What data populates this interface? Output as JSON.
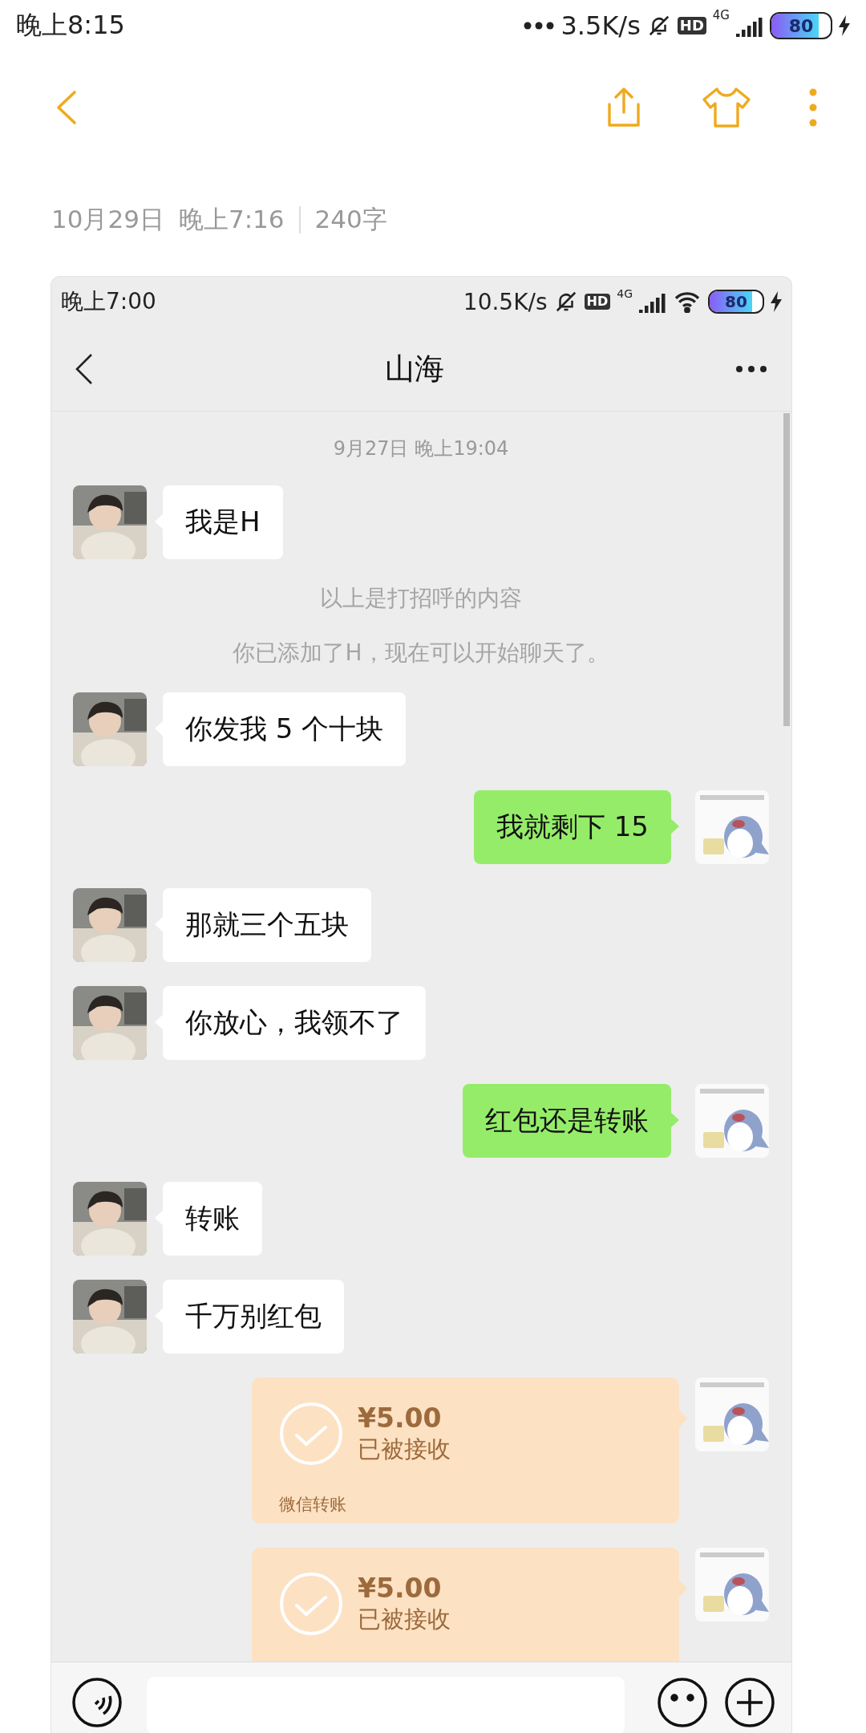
{
  "status_bar": {
    "time": "晚上8:15",
    "speed": "3.5K/s",
    "hd": "HD",
    "network": "4G",
    "battery": "80",
    "charging": true
  },
  "note_meta": {
    "date": "10月29日",
    "time": "晚上7:16",
    "word_count": "240字"
  },
  "screenshot": {
    "status_bar": {
      "time": "晚上7:00",
      "speed": "10.5K/s",
      "hd": "HD",
      "network": "4G",
      "wifi": true,
      "battery": "80",
      "charging": true
    },
    "chat_title": "山海",
    "messages": [
      {
        "kind": "time",
        "text": "9月27日 晚上19:04"
      },
      {
        "kind": "text",
        "outgoing": false,
        "text": "我是H"
      },
      {
        "kind": "notice",
        "text": "以上是打招呼的内容"
      },
      {
        "kind": "notice",
        "text": "你已添加了H，现在可以开始聊天了。"
      },
      {
        "kind": "text",
        "outgoing": false,
        "text": "你发我 5 个十块"
      },
      {
        "kind": "text",
        "outgoing": true,
        "text": "我就剩下 15"
      },
      {
        "kind": "text",
        "outgoing": false,
        "text": "那就三个五块"
      },
      {
        "kind": "text",
        "outgoing": false,
        "text": "你放心，我领不了"
      },
      {
        "kind": "text",
        "outgoing": true,
        "text": "红包还是转账"
      },
      {
        "kind": "text",
        "outgoing": false,
        "text": "转账"
      },
      {
        "kind": "text",
        "outgoing": false,
        "text": "千万别红包"
      },
      {
        "kind": "transfer",
        "outgoing": true,
        "amount": "¥5.00",
        "status": "已被接收",
        "footer": "微信转账"
      },
      {
        "kind": "transfer",
        "outgoing": true,
        "amount": "¥5.00",
        "status": "已被接收"
      }
    ]
  }
}
